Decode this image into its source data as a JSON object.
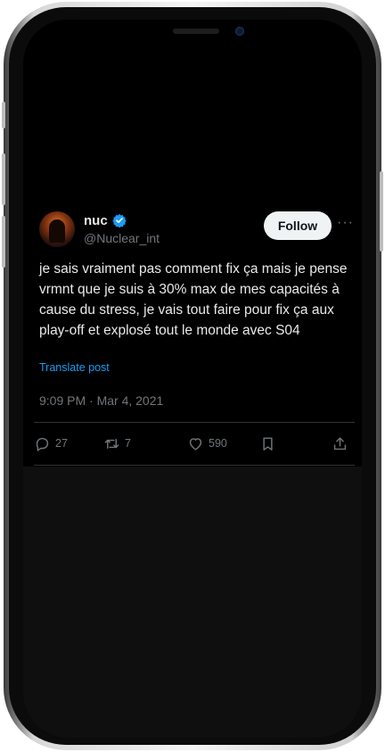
{
  "tweet": {
    "display_name": "nuc",
    "handle": "@Nuclear_int",
    "follow_label": "Follow",
    "more_icon": "ellipsis-icon",
    "text": "je sais vraiment pas comment fix ça mais je pense vrmnt que je suis à 30% max de mes capacités à cause du stress, je vais tout faire pour fix ça aux play-off et explosé tout le monde avec S04",
    "translate_label": "Translate post",
    "timestamp": "9:09 PM · Mar 4, 2021",
    "actions": {
      "replies": "27",
      "reposts": "7",
      "likes": "590"
    }
  },
  "colors": {
    "background": "#000000",
    "text": "#e7e9ea",
    "muted": "#71767b",
    "link": "#1d9bf0",
    "verified": "#1d9bf0",
    "follow_bg": "#eff3f4"
  }
}
